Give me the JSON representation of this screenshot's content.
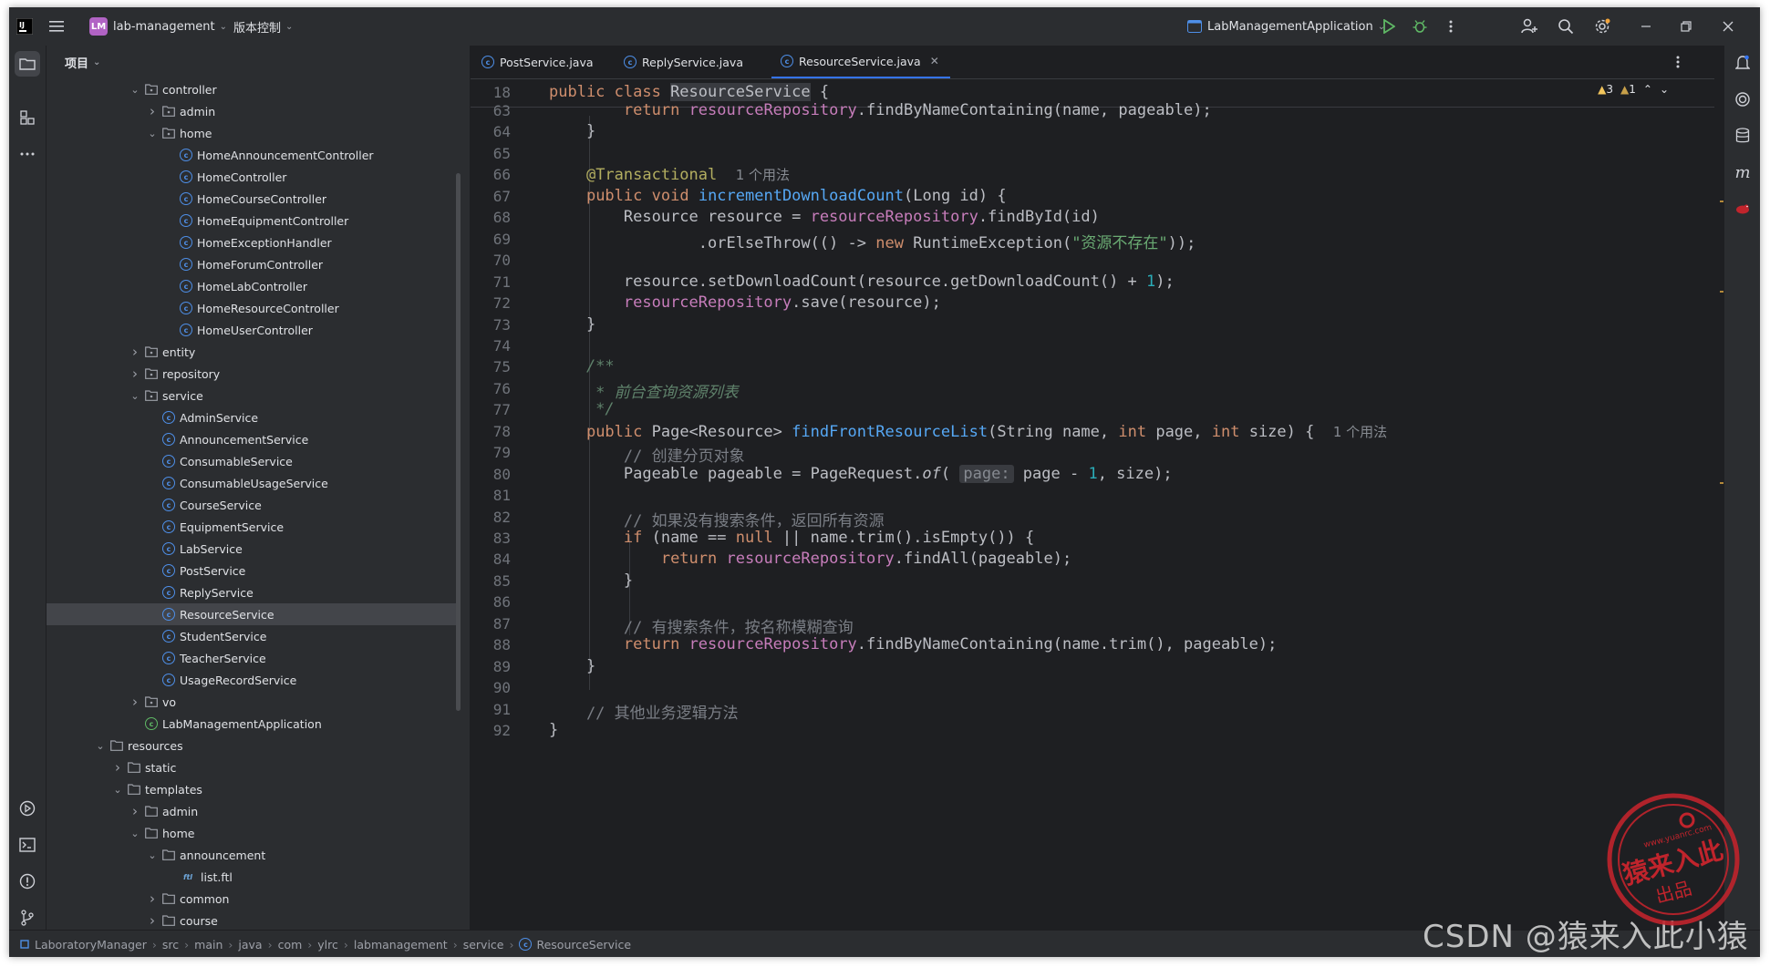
{
  "titlebar": {
    "project_badge": "LM",
    "project_name": "lab-management",
    "vcs_label": "版本控制",
    "run_config": "LabManagementApplication"
  },
  "project_panel": {
    "header": "项目",
    "tree": [
      {
        "label": "controller",
        "type": "package",
        "depth": 3,
        "arrow": "v"
      },
      {
        "label": "admin",
        "type": "package",
        "depth": 4,
        "arrow": ">"
      },
      {
        "label": "home",
        "type": "package",
        "depth": 4,
        "arrow": "v"
      },
      {
        "label": "HomeAnnouncementController",
        "type": "class",
        "depth": 5,
        "arrow": ""
      },
      {
        "label": "HomeController",
        "type": "class",
        "depth": 5,
        "arrow": ""
      },
      {
        "label": "HomeCourseController",
        "type": "class",
        "depth": 5,
        "arrow": ""
      },
      {
        "label": "HomeEquipmentController",
        "type": "class",
        "depth": 5,
        "arrow": ""
      },
      {
        "label": "HomeExceptionHandler",
        "type": "class",
        "depth": 5,
        "arrow": ""
      },
      {
        "label": "HomeForumController",
        "type": "class",
        "depth": 5,
        "arrow": ""
      },
      {
        "label": "HomeLabController",
        "type": "class",
        "depth": 5,
        "arrow": ""
      },
      {
        "label": "HomeResourceController",
        "type": "class",
        "depth": 5,
        "arrow": ""
      },
      {
        "label": "HomeUserController",
        "type": "class",
        "depth": 5,
        "arrow": ""
      },
      {
        "label": "entity",
        "type": "package",
        "depth": 3,
        "arrow": ">"
      },
      {
        "label": "repository",
        "type": "package",
        "depth": 3,
        "arrow": ">"
      },
      {
        "label": "service",
        "type": "package",
        "depth": 3,
        "arrow": "v"
      },
      {
        "label": "AdminService",
        "type": "class",
        "depth": 4,
        "arrow": ""
      },
      {
        "label": "AnnouncementService",
        "type": "class",
        "depth": 4,
        "arrow": ""
      },
      {
        "label": "ConsumableService",
        "type": "class",
        "depth": 4,
        "arrow": ""
      },
      {
        "label": "ConsumableUsageService",
        "type": "class",
        "depth": 4,
        "arrow": ""
      },
      {
        "label": "CourseService",
        "type": "class",
        "depth": 4,
        "arrow": ""
      },
      {
        "label": "EquipmentService",
        "type": "class",
        "depth": 4,
        "arrow": ""
      },
      {
        "label": "LabService",
        "type": "class",
        "depth": 4,
        "arrow": ""
      },
      {
        "label": "PostService",
        "type": "class",
        "depth": 4,
        "arrow": ""
      },
      {
        "label": "ReplyService",
        "type": "class",
        "depth": 4,
        "arrow": ""
      },
      {
        "label": "ResourceService",
        "type": "class",
        "depth": 4,
        "arrow": "",
        "selected": true
      },
      {
        "label": "StudentService",
        "type": "class",
        "depth": 4,
        "arrow": ""
      },
      {
        "label": "TeacherService",
        "type": "class",
        "depth": 4,
        "arrow": ""
      },
      {
        "label": "UsageRecordService",
        "type": "class",
        "depth": 4,
        "arrow": ""
      },
      {
        "label": "vo",
        "type": "package",
        "depth": 3,
        "arrow": ">"
      },
      {
        "label": "LabManagementApplication",
        "type": "app",
        "depth": 3,
        "arrow": ""
      },
      {
        "label": "resources",
        "type": "folder",
        "depth": 1,
        "arrow": "v"
      },
      {
        "label": "static",
        "type": "folder",
        "depth": 2,
        "arrow": ">"
      },
      {
        "label": "templates",
        "type": "folder",
        "depth": 2,
        "arrow": "v"
      },
      {
        "label": "admin",
        "type": "folder",
        "depth": 3,
        "arrow": ">"
      },
      {
        "label": "home",
        "type": "folder",
        "depth": 3,
        "arrow": "v"
      },
      {
        "label": "announcement",
        "type": "folder",
        "depth": 4,
        "arrow": "v"
      },
      {
        "label": "list.ftl",
        "type": "ftl",
        "depth": 5,
        "arrow": ""
      },
      {
        "label": "common",
        "type": "folder",
        "depth": 4,
        "arrow": ">"
      },
      {
        "label": "course",
        "type": "folder",
        "depth": 4,
        "arrow": ">"
      }
    ]
  },
  "editor": {
    "tabs": [
      {
        "label": "PostService.java",
        "active": false
      },
      {
        "label": "ReplyService.java",
        "active": false
      },
      {
        "label": "ResourceService.java",
        "active": true
      }
    ],
    "inspections": {
      "warnings": "3",
      "weak_warnings": "1"
    },
    "sticky_line": {
      "num": "18",
      "text": "public class ResourceService {"
    },
    "lines": [
      {
        "num": "63",
        "text": "        return resourceRepository.findByNameContaining(name, pageable);"
      },
      {
        "num": "64",
        "text": "    }"
      },
      {
        "num": "65",
        "text": ""
      },
      {
        "num": "66",
        "text": "    @Transactional  1 个用法"
      },
      {
        "num": "67",
        "text": "    public void incrementDownloadCount(Long id) {"
      },
      {
        "num": "68",
        "text": "        Resource resource = resourceRepository.findById(id)"
      },
      {
        "num": "69",
        "text": "                .orElseThrow(() -> new RuntimeException(\"资源不存在\"));"
      },
      {
        "num": "70",
        "text": ""
      },
      {
        "num": "71",
        "text": "        resource.setDownloadCount(resource.getDownloadCount() + 1);"
      },
      {
        "num": "72",
        "text": "        resourceRepository.save(resource);"
      },
      {
        "num": "73",
        "text": "    }"
      },
      {
        "num": "74",
        "text": ""
      },
      {
        "num": "75",
        "text": "    /**"
      },
      {
        "num": "76",
        "text": "     * 前台查询资源列表"
      },
      {
        "num": "77",
        "text": "     */"
      },
      {
        "num": "78",
        "text": "    public Page<Resource> findFrontResourceList(String name, int page, int size) {  1 个用法"
      },
      {
        "num": "79",
        "text": "        // 创建分页对象"
      },
      {
        "num": "80",
        "text": "        Pageable pageable = PageRequest.of( page: page - 1, size);"
      },
      {
        "num": "81",
        "text": ""
      },
      {
        "num": "82",
        "text": "        // 如果没有搜索条件，返回所有资源"
      },
      {
        "num": "83",
        "text": "        if (name == null || name.trim().isEmpty()) {"
      },
      {
        "num": "84",
        "text": "            return resourceRepository.findAll(pageable);"
      },
      {
        "num": "85",
        "text": "        }"
      },
      {
        "num": "86",
        "text": ""
      },
      {
        "num": "87",
        "text": "        // 有搜索条件，按名称模糊查询"
      },
      {
        "num": "88",
        "text": "        return resourceRepository.findByNameContaining(name.trim(), pageable);"
      },
      {
        "num": "89",
        "text": "    }"
      },
      {
        "num": "90",
        "text": ""
      },
      {
        "num": "91",
        "text": "    // 其他业务逻辑方法"
      },
      {
        "num": "92",
        "text": "}"
      }
    ]
  },
  "statusbar": {
    "breadcrumbs": [
      "LaboratoryManager",
      "src",
      "main",
      "java",
      "com",
      "ylrc",
      "labmanagement",
      "service",
      "ResourceService"
    ]
  },
  "watermark": "CSDN @猿来入此小猿",
  "stamp": {
    "text": "猿来入此",
    "sub": "出品",
    "url": "www.yuanrc.com"
  },
  "colors": {
    "accent": "#3574f0",
    "keyword": "#cf8e6d",
    "function": "#56a8f5",
    "field": "#c77dbb",
    "string": "#6aab73",
    "number": "#2aacb8",
    "comment": "#7a7e85",
    "annotation": "#b3ae60",
    "stamp": "#c0242c"
  }
}
